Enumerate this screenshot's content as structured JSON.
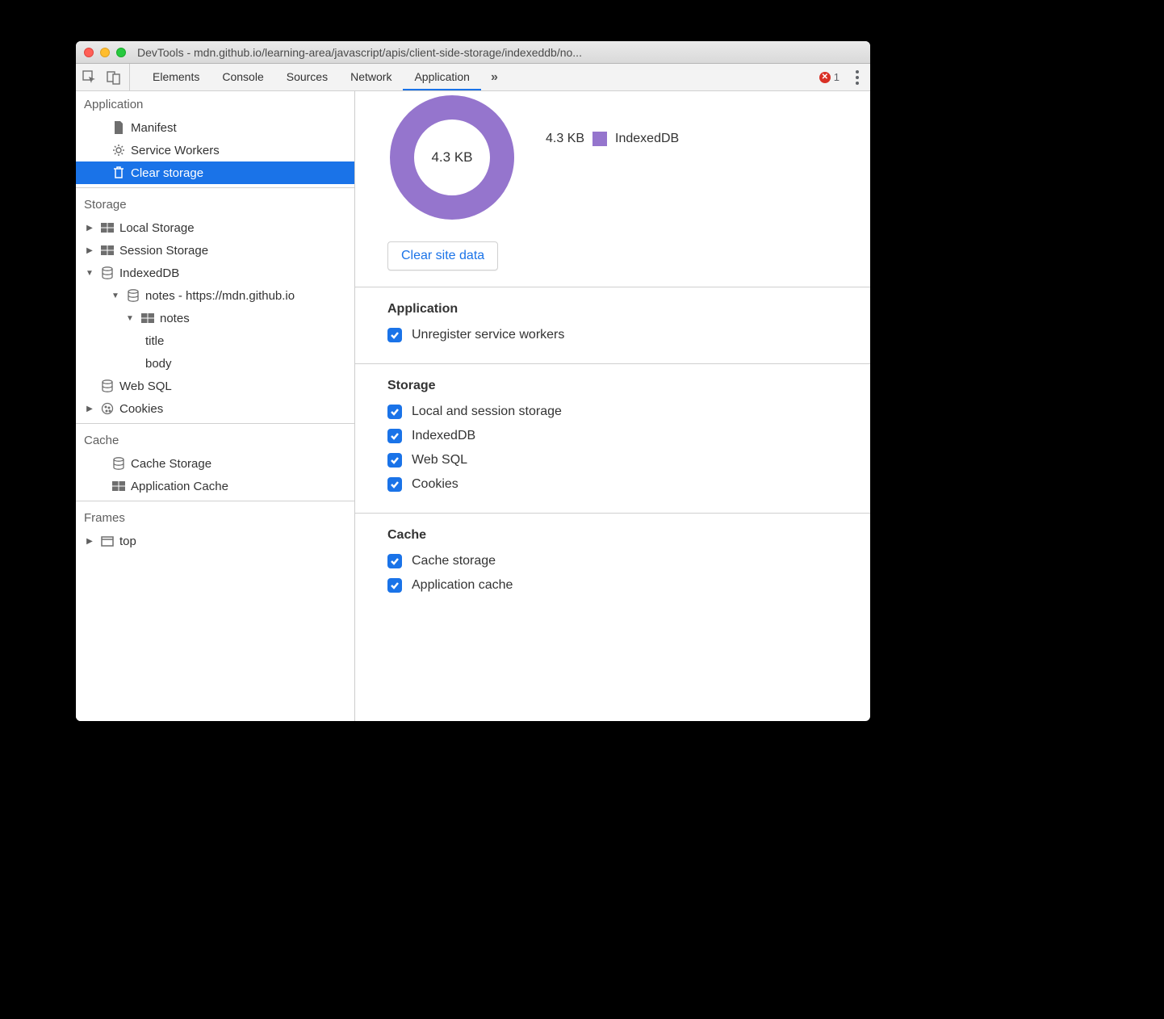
{
  "window": {
    "title": "DevTools - mdn.github.io/learning-area/javascript/apis/client-side-storage/indexeddb/no..."
  },
  "toolbar": {
    "tabs": [
      "Elements",
      "Console",
      "Sources",
      "Network",
      "Application"
    ],
    "active_tab": "Application",
    "more_glyph": "»",
    "error_count": "1"
  },
  "sidebar": {
    "groups": {
      "application": {
        "title": "Application",
        "items": {
          "manifest": "Manifest",
          "service_workers": "Service Workers",
          "clear_storage": "Clear storage"
        }
      },
      "storage": {
        "title": "Storage",
        "items": {
          "local_storage": "Local Storage",
          "session_storage": "Session Storage",
          "indexeddb": "IndexedDB",
          "db_notes": "notes - https://mdn.github.io",
          "store_notes": "notes",
          "field_title": "title",
          "field_body": "body",
          "web_sql": "Web SQL",
          "cookies": "Cookies"
        }
      },
      "cache": {
        "title": "Cache",
        "items": {
          "cache_storage": "Cache Storage",
          "app_cache": "Application Cache"
        }
      },
      "frames": {
        "title": "Frames",
        "items": {
          "top": "top"
        }
      }
    }
  },
  "main": {
    "donut_center": "4.3 KB",
    "legend_value": "4.3 KB",
    "legend_label": "IndexedDB",
    "clear_button": "Clear site data",
    "sections": {
      "application": {
        "title": "Application",
        "checks": {
          "unregister": "Unregister service workers"
        }
      },
      "storage": {
        "title": "Storage",
        "checks": {
          "local_session": "Local and session storage",
          "indexeddb": "IndexedDB",
          "web_sql": "Web SQL",
          "cookies": "Cookies"
        }
      },
      "cache": {
        "title": "Cache",
        "checks": {
          "cache_storage": "Cache storage",
          "app_cache": "Application cache"
        }
      }
    }
  },
  "chart_data": {
    "type": "pie",
    "title": "4.3 KB",
    "series": [
      {
        "name": "IndexedDB",
        "values": [
          4.3
        ],
        "unit": "KB",
        "color": "#9575cd",
        "fraction": 1.0
      }
    ]
  }
}
